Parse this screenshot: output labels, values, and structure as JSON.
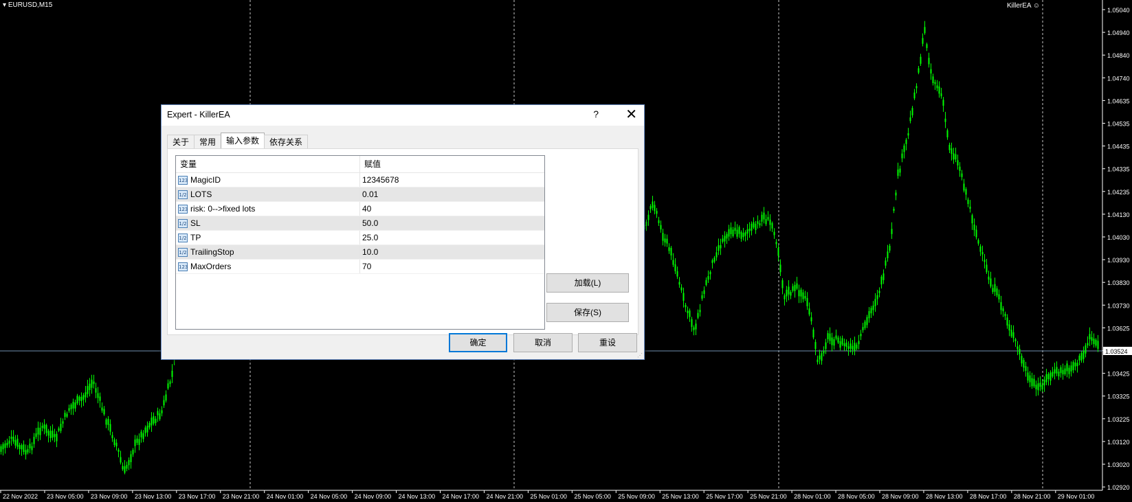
{
  "chart": {
    "symbol": "EURUSD,M15",
    "ea_label": "KillerEA",
    "smiley_icon": "smiley-icon",
    "current_price": "1.03524",
    "price_labels": [
      "1.05040",
      "1.04940",
      "1.04840",
      "1.04740",
      "1.04635",
      "1.04535",
      "1.04435",
      "1.04335",
      "1.04235",
      "1.04130",
      "1.04030",
      "1.03930",
      "1.03830",
      "1.03730",
      "1.03625",
      "1.03525",
      "1.03425",
      "1.03325",
      "1.03225",
      "1.03120",
      "1.03020",
      "1.02920"
    ],
    "time_labels": [
      "22 Nov 2022",
      "23 Nov 05:00",
      "23 Nov 09:00",
      "23 Nov 13:00",
      "23 Nov 17:00",
      "23 Nov 21:00",
      "24 Nov 01:00",
      "24 Nov 05:00",
      "24 Nov 09:00",
      "24 Nov 13:00",
      "24 Nov 17:00",
      "24 Nov 21:00",
      "25 Nov 01:00",
      "25 Nov 05:00",
      "25 Nov 09:00",
      "25 Nov 13:00",
      "25 Nov 17:00",
      "25 Nov 21:00",
      "28 Nov 01:00",
      "28 Nov 05:00",
      "28 Nov 09:00",
      "28 Nov 13:00",
      "28 Nov 17:00",
      "28 Nov 21:00",
      "29 Nov 01:00"
    ],
    "colors": {
      "bg": "#000000",
      "candle": "#00ff00",
      "axis": "#ffffff",
      "grid": "#c8c8c8",
      "price_line": "#6f8faf"
    }
  },
  "dialog": {
    "title": "Expert - KillerEA",
    "help_label": "?",
    "close_label": "✕",
    "tabs": [
      {
        "label": "关于",
        "active": false
      },
      {
        "label": "常用",
        "active": false
      },
      {
        "label": "输入参数",
        "active": true
      },
      {
        "label": "依存关系",
        "active": false
      }
    ],
    "headers": {
      "variable": "变量",
      "value": "赋值"
    },
    "params": [
      {
        "name": "MagicID",
        "value": "12345678",
        "type_icon": "123"
      },
      {
        "name": "LOTS",
        "value": "0.01",
        "type_icon": "1/2"
      },
      {
        "name": "risk: 0-->fixed lots",
        "value": "40",
        "type_icon": "123"
      },
      {
        "name": "SL",
        "value": "50.0",
        "type_icon": "1/2"
      },
      {
        "name": "TP",
        "value": "25.0",
        "type_icon": "1/2"
      },
      {
        "name": "TrailingStop",
        "value": "10.0",
        "type_icon": "1/2"
      },
      {
        "name": "MaxOrders",
        "value": "70",
        "type_icon": "123"
      }
    ],
    "buttons": {
      "load": "加载(L)",
      "save": "保存(S)",
      "ok": "确定",
      "cancel": "取消",
      "reset": "重设"
    }
  }
}
